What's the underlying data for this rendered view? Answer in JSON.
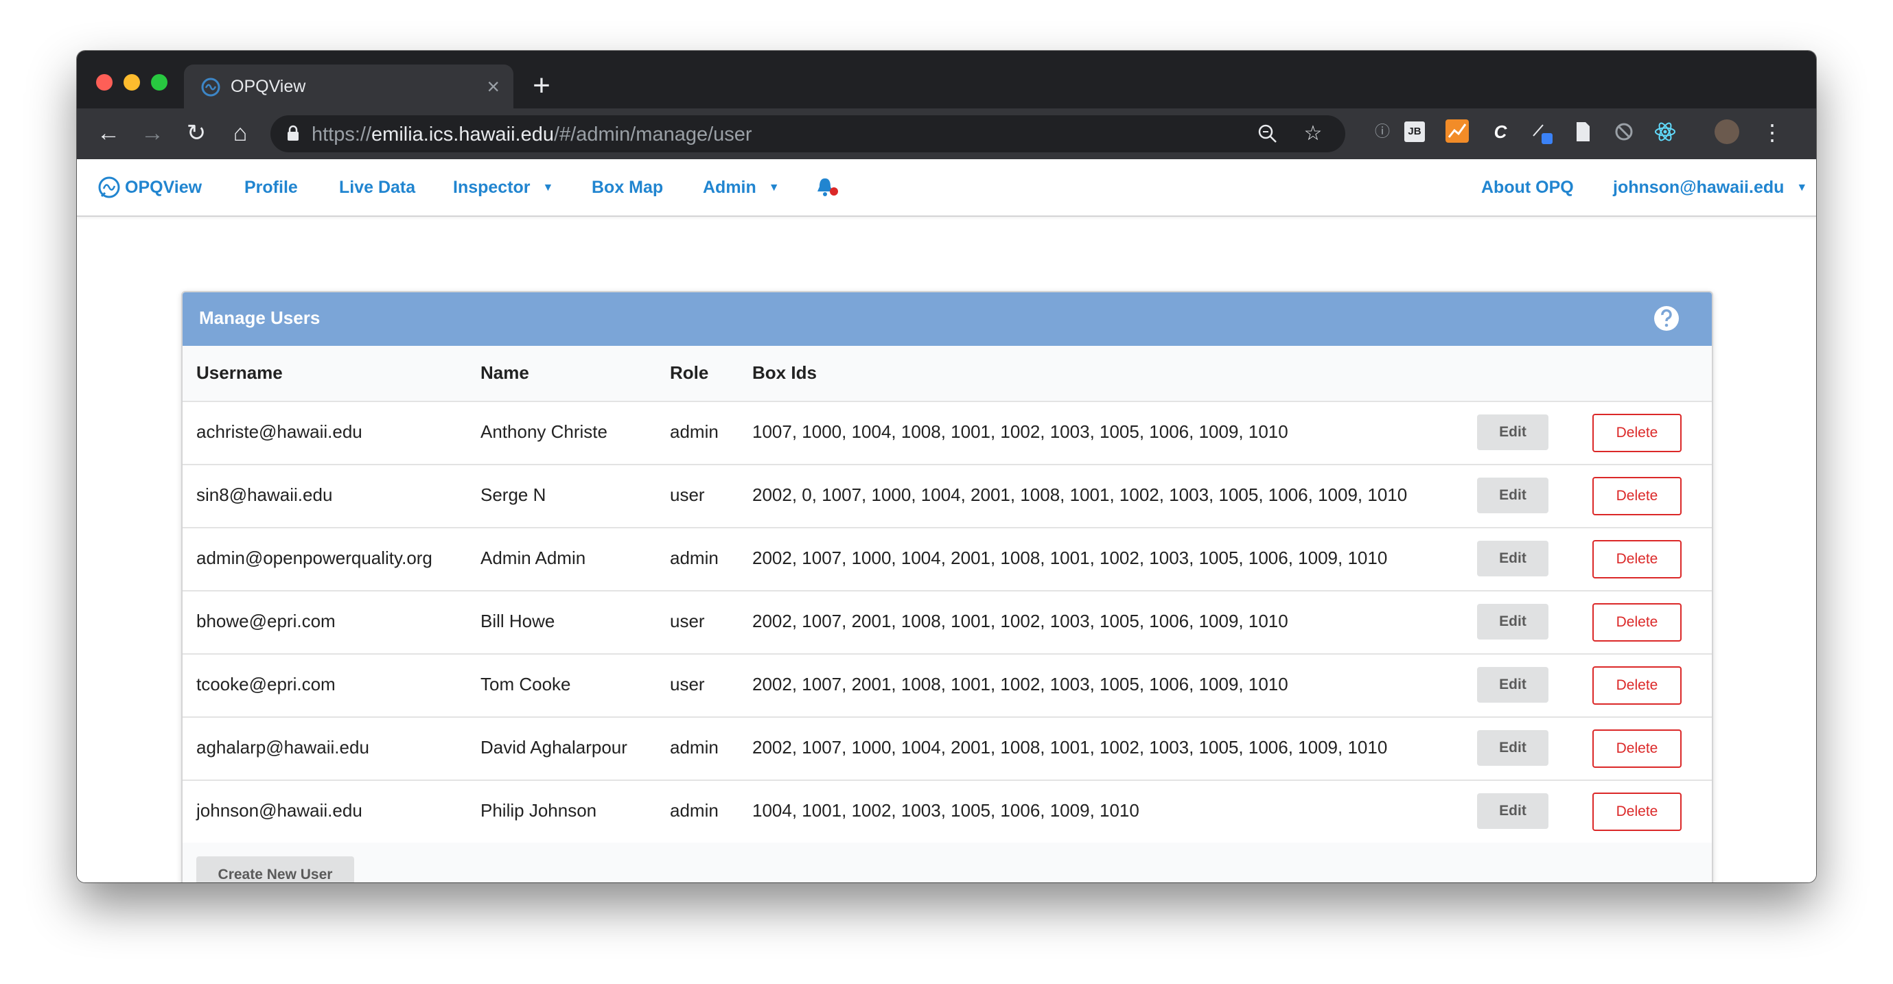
{
  "browser": {
    "tab_title": "OPQView",
    "tab_close": "×",
    "new_tab": "+",
    "url_scheme": "https://",
    "url_host": "emilia.ics.hawaii.edu",
    "url_path": "/#/admin/manage/user",
    "ext_jb_label": "JB"
  },
  "navbar": {
    "brand": "OPQView",
    "profile": "Profile",
    "live_data": "Live Data",
    "inspector": "Inspector",
    "box_map": "Box Map",
    "admin": "Admin",
    "about": "About OPQ",
    "user": "johnson@hawaii.edu",
    "colors": {
      "link": "#2185d0",
      "bell_dot": "#db2828"
    }
  },
  "card": {
    "title": "Manage Users",
    "header_color": "#7ba5d7",
    "columns": [
      "Username",
      "Name",
      "Role",
      "Box Ids"
    ],
    "edit_label": "Edit",
    "delete_label": "Delete",
    "create_label": "Create New User",
    "rows": [
      {
        "username": "achriste@hawaii.edu",
        "name": "Anthony Christe",
        "role": "admin",
        "box_ids": "1007, 1000, 1004, 1008, 1001, 1002, 1003, 1005, 1006, 1009, 1010"
      },
      {
        "username": "sin8@hawaii.edu",
        "name": "Serge N",
        "role": "user",
        "box_ids": "2002, 0, 1007, 1000, 1004, 2001, 1008, 1001, 1002, 1003, 1005, 1006, 1009, 1010"
      },
      {
        "username": "admin@openpowerquality.org",
        "name": "Admin Admin",
        "role": "admin",
        "box_ids": "2002, 1007, 1000, 1004, 2001, 1008, 1001, 1002, 1003, 1005, 1006, 1009, 1010"
      },
      {
        "username": "bhowe@epri.com",
        "name": "Bill Howe",
        "role": "user",
        "box_ids": "2002, 1007, 2001, 1008, 1001, 1002, 1003, 1005, 1006, 1009, 1010"
      },
      {
        "username": "tcooke@epri.com",
        "name": "Tom Cooke",
        "role": "user",
        "box_ids": "2002, 1007, 2001, 1008, 1001, 1002, 1003, 1005, 1006, 1009, 1010"
      },
      {
        "username": "aghalarp@hawaii.edu",
        "name": "David Aghalarpour",
        "role": "admin",
        "box_ids": "2002, 1007, 1000, 1004, 2001, 1008, 1001, 1002, 1003, 1005, 1006, 1009, 1010"
      },
      {
        "username": "johnson@hawaii.edu",
        "name": "Philip Johnson",
        "role": "admin",
        "box_ids": "1004, 1001, 1002, 1003, 1005, 1006, 1009, 1010"
      }
    ]
  }
}
